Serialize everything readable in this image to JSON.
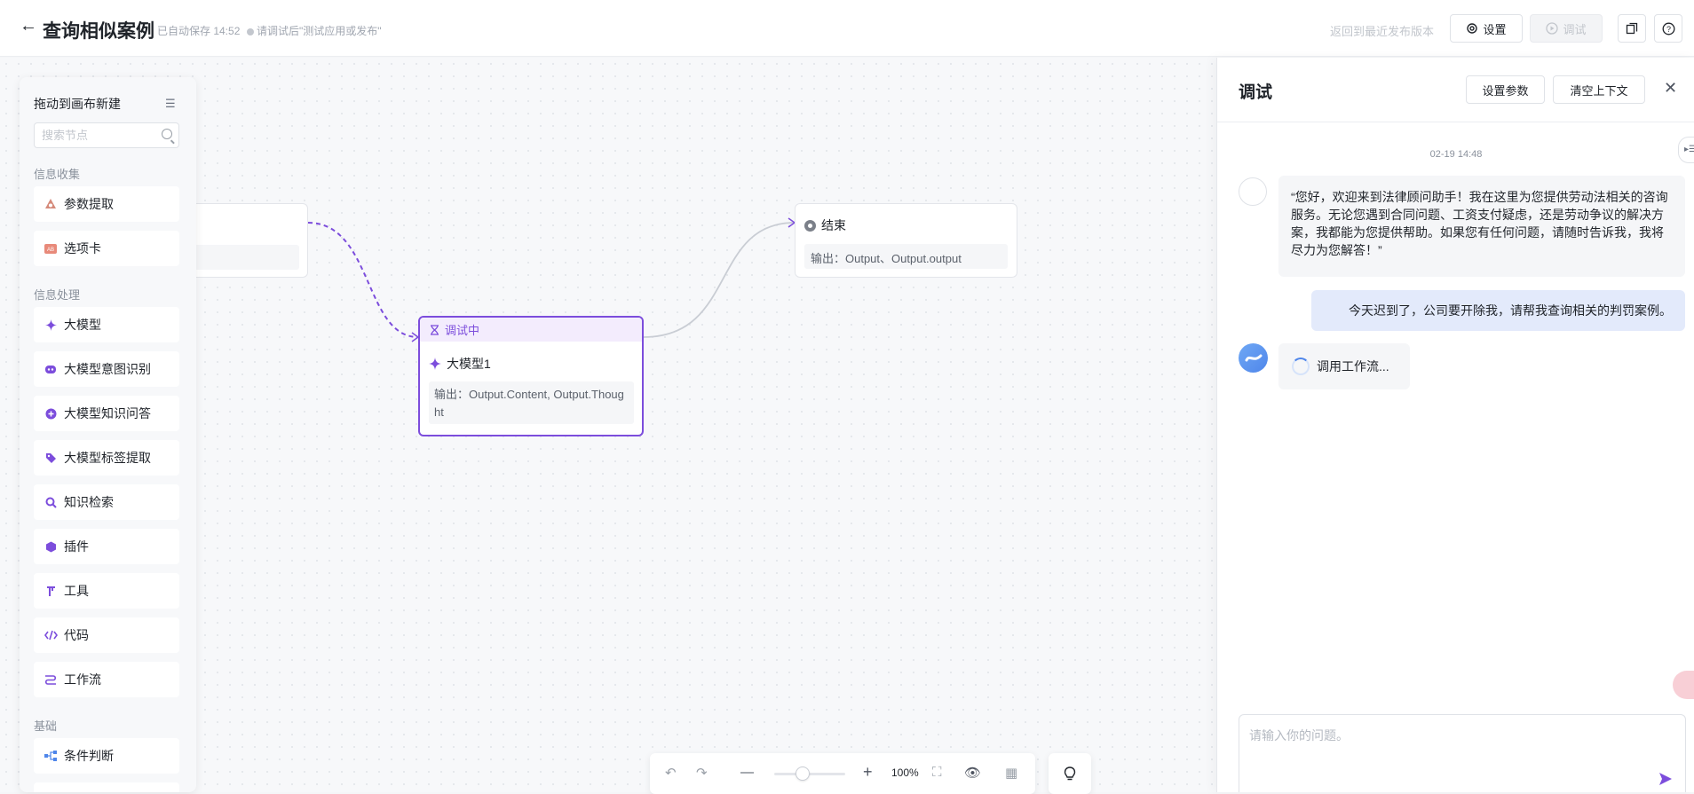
{
  "header": {
    "back_icon": "arrow-left-icon",
    "title": "查询相似案例",
    "autosave": "已自动保存 14:52",
    "hint": "请调试后\"测试应用或发布\"",
    "restore": "返回到最近发布版本",
    "settings_label": "设置",
    "debug_label": "调试"
  },
  "node_panel": {
    "title": "拖动到画布新建",
    "search_placeholder": "搜索节点",
    "sections": [
      {
        "label": "信息收集",
        "items": [
          {
            "label": "参数提取",
            "icon": "param-extract-icon"
          },
          {
            "label": "选项卡",
            "icon": "options-card-icon"
          }
        ]
      },
      {
        "label": "信息处理",
        "items": [
          {
            "label": "大模型",
            "icon": "sparkle-icon"
          },
          {
            "label": "大模型意图识别",
            "icon": "robot-icon"
          },
          {
            "label": "大模型知识问答",
            "icon": "knowledge-qa-icon"
          },
          {
            "label": "大模型标签提取",
            "icon": "tag-icon"
          },
          {
            "label": "知识检索",
            "icon": "search-icon"
          },
          {
            "label": "插件",
            "icon": "plugin-icon"
          },
          {
            "label": "工具",
            "icon": "tool-icon"
          },
          {
            "label": "代码",
            "icon": "code-icon"
          },
          {
            "label": "工作流",
            "icon": "workflow-icon"
          }
        ]
      },
      {
        "label": "基础",
        "items": [
          {
            "label": "条件判断",
            "icon": "branch-icon"
          }
        ]
      }
    ]
  },
  "canvas": {
    "end_node": {
      "title": "结束",
      "output": "输出：Output、Output.output"
    },
    "llm_node": {
      "status": "调试中",
      "title": "大模型1",
      "output": "输出：Output.Content, Output.Thought"
    },
    "zoom": "100%"
  },
  "debug_panel": {
    "title": "调试",
    "set_params": "设置参数",
    "clear_context": "清空上下文",
    "timestamp": "02-19 14:48",
    "messages": [
      {
        "role": "bot",
        "text": "“您好，欢迎来到法律顾问助手！我在这里为您提供劳动法相关的咨询服务。无论您遇到合同问题、工资支付疑虑，还是劳动争议的解决方案，我都能为您提供帮助。如果您有任何问题，请随时告诉我，我将尽力为您解答！”"
      },
      {
        "role": "user",
        "text": "今天迟到了，公司要开除我，请帮我查询相关的判罚案例。"
      },
      {
        "role": "bot-loading",
        "text": "调用工作流..."
      }
    ],
    "input_placeholder": "请输入你的问题。"
  },
  "colors": {
    "accent": "#7c4ddc",
    "user_bubble": "#e3eafb",
    "bot_bubble": "#f5f6f8"
  }
}
